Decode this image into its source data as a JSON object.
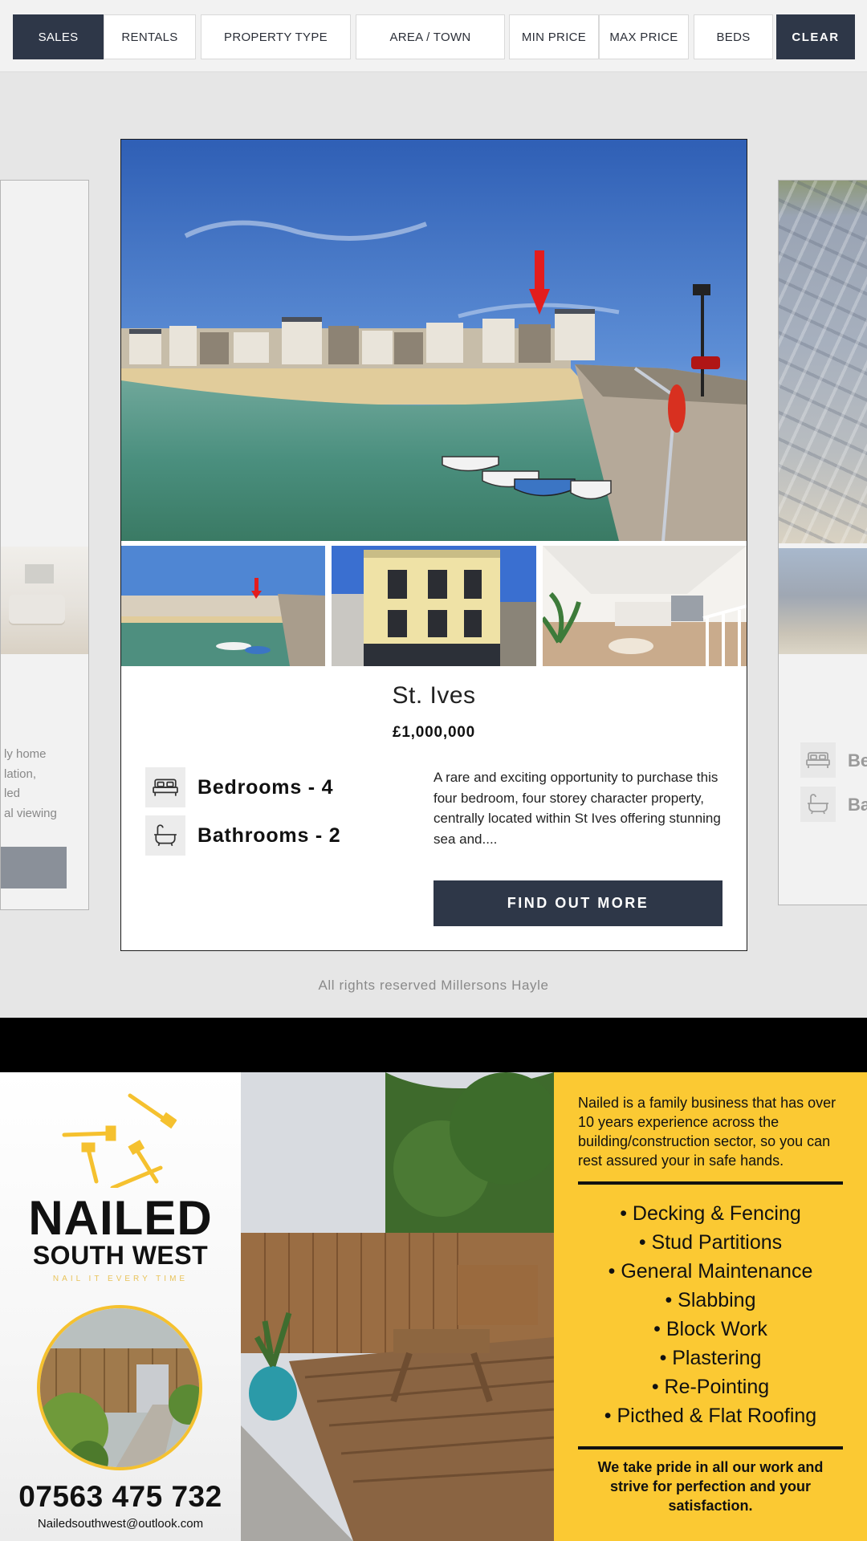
{
  "filters": {
    "sales": "SALES",
    "rentals": "RENTALS",
    "property_type": "PROPERTY TYPE",
    "area_town": "AREA / TOWN",
    "min_price": "MIN PRICE",
    "max_price": "MAX PRICE",
    "beds": "BEDS",
    "clear": "CLEAR"
  },
  "carousel": {
    "prev_card": {
      "desc_lines": [
        "ly home",
        "lation,",
        "led",
        "al viewing"
      ]
    },
    "current": {
      "title": "St. Ives",
      "price": "£1,000,000",
      "bedrooms": "Bedrooms - 4",
      "bathrooms": "Bathrooms - 2",
      "description": "A rare and exciting opportunity to purchase this four bedroom, four storey character property, centrally located within St Ives offering stunning sea and....",
      "cta": "FIND OUT MORE",
      "bed_icon": "bed-icon",
      "bath_icon": "bath-icon"
    },
    "next_card": {
      "bed_label": "Be",
      "bath_label": "Ba"
    }
  },
  "footer": {
    "rights": "All rights reserved Millersons Hayle"
  },
  "ad": {
    "brand_line1": "NAILED",
    "brand_line2": "SOUTH WEST",
    "tagline": "NAIL IT EVERY TIME",
    "phone": "07563 475 732",
    "email": "Nailedsouthwest@outlook.com",
    "intro": "Nailed is a family business that has over 10 years experience across the building/construction sector, so you can rest assured your in safe hands.",
    "services": [
      "• Decking & Fencing",
      "• Stud Partitions",
      "• General Maintenance",
      "• Slabbing",
      "• Block Work",
      "• Plastering",
      "• Re-Pointing",
      "• Picthed & Flat Roofing"
    ],
    "outro": "We take pride in all our work and strive for perfection and your satisfaction.",
    "accent_color": "#fbc933"
  },
  "colors": {
    "navy": "#2e3748",
    "page_bg": "#e6e6e6"
  }
}
